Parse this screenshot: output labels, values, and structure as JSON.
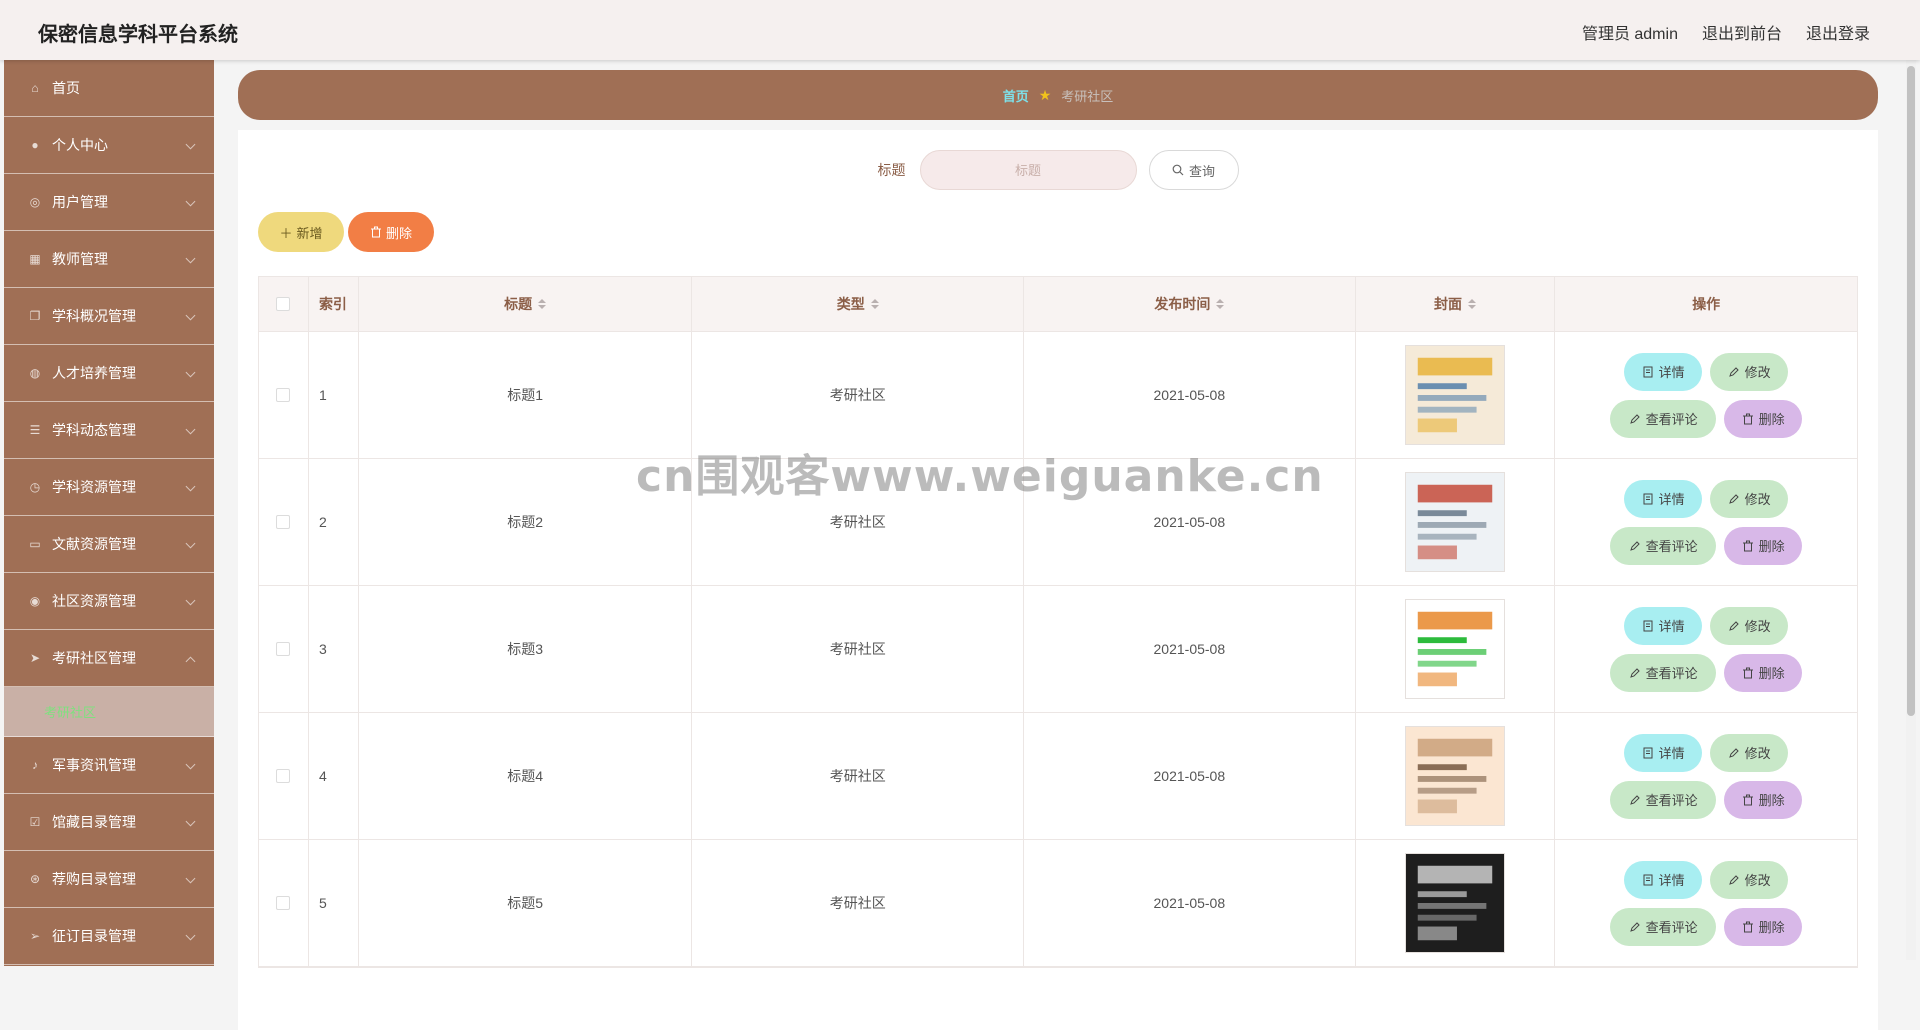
{
  "app_title": "保密信息学科平台系统",
  "header": {
    "user": "管理员 admin",
    "to_front": "退出到前台",
    "logout": "退出登录"
  },
  "sidebar": {
    "items": [
      {
        "label": "首页",
        "icon": "home-icon",
        "chevron": false
      },
      {
        "label": "个人中心",
        "icon": "user-icon",
        "chevron": true
      },
      {
        "label": "用户管理",
        "icon": "users-icon",
        "chevron": true
      },
      {
        "label": "教师管理",
        "icon": "grid-icon",
        "chevron": true
      },
      {
        "label": "学科概况管理",
        "icon": "copy-icon",
        "chevron": true
      },
      {
        "label": "人才培养管理",
        "icon": "globe-icon",
        "chevron": true
      },
      {
        "label": "学科动态管理",
        "icon": "list-icon",
        "chevron": true
      },
      {
        "label": "学科资源管理",
        "icon": "clock-icon",
        "chevron": true
      },
      {
        "label": "文献资源管理",
        "icon": "doc-icon",
        "chevron": true
      },
      {
        "label": "社区资源管理",
        "icon": "community-icon",
        "chevron": true
      },
      {
        "label": "考研社区管理",
        "icon": "send-icon",
        "chevron": true,
        "expanded": true
      },
      {
        "label": "军事资讯管理",
        "icon": "mic-icon",
        "chevron": true
      },
      {
        "label": "馆藏目录管理",
        "icon": "check-icon",
        "chevron": true
      },
      {
        "label": "荐购目录管理",
        "icon": "compass-icon",
        "chevron": true
      },
      {
        "label": "征订目录管理",
        "icon": "navigation-icon",
        "chevron": true
      }
    ],
    "sub_item": "考研社区"
  },
  "breadcrumb": {
    "home": "首页",
    "current": "考研社区"
  },
  "search": {
    "label": "标题",
    "placeholder": "标题",
    "button": "查询"
  },
  "actions": {
    "add": "新增",
    "delete": "删除"
  },
  "table": {
    "headers": {
      "index": "索引",
      "title": "标题",
      "type": "类型",
      "date": "发布时间",
      "cover": "封面",
      "ops": "操作"
    },
    "row_ops": {
      "detail": "详情",
      "edit": "修改",
      "comments": "查看评论",
      "delete": "删除"
    },
    "rows": [
      {
        "index": "1",
        "title": "标题1",
        "type": "考研社区",
        "date": "2021-05-08"
      },
      {
        "index": "2",
        "title": "标题2",
        "type": "考研社区",
        "date": "2021-05-08"
      },
      {
        "index": "3",
        "title": "标题3",
        "type": "考研社区",
        "date": "2021-05-08"
      },
      {
        "index": "4",
        "title": "标题4",
        "type": "考研社区",
        "date": "2021-05-08"
      },
      {
        "index": "5",
        "title": "标题5",
        "type": "考研社区",
        "date": "2021-05-08"
      }
    ]
  },
  "watermark": "cn围观客www.weiguanke.cn",
  "colors": {
    "sidebar": "#a06f55",
    "accent": "#a06f55",
    "add_button": "#efd97d",
    "delete_button": "#f27e45"
  }
}
